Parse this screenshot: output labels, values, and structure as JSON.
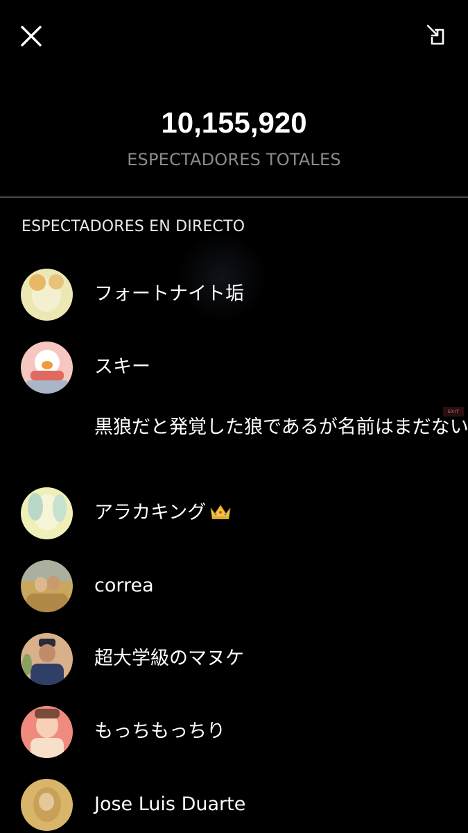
{
  "header": {
    "close_icon": "close-icon",
    "minimize_icon": "minimize-icon",
    "total_viewers": "10,155,920",
    "total_label": "ESPECTADORES TOTALES"
  },
  "section": {
    "title": "ESPECTADORES EN DIRECTO"
  },
  "viewers": [
    {
      "name": "フォートナイト垢",
      "avatar_color": "#ece8b5"
    },
    {
      "name": "スキー",
      "avatar_color": "#f6c6c0"
    },
    {
      "name": "黒狼だと発覚した狼であるが名前はまだない",
      "avatar_color": ""
    },
    {
      "name": "アラカキング",
      "badge": "crown",
      "avatar_color": "#eef0b8"
    },
    {
      "name": "correa",
      "avatar_color": "#c9a75c"
    },
    {
      "name": "超大学級のマヌケ",
      "avatar_color": "#d8b08a"
    },
    {
      "name": "もっちもっちり",
      "avatar_color": "#f08a7e"
    },
    {
      "name": "Jose Luis Duarte",
      "avatar_color": "#d9b56a"
    }
  ],
  "overlay": {
    "exit_label": "EXIT"
  }
}
